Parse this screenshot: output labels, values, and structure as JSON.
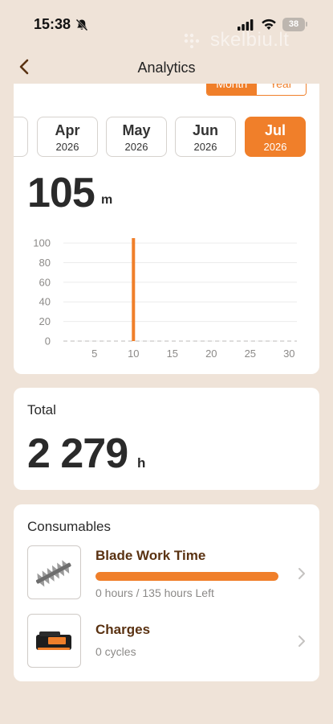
{
  "status_bar": {
    "time": "15:38",
    "battery": "38",
    "watermark": "skelbiu.lt"
  },
  "nav": {
    "title": "Analytics",
    "back_icon": "chevron-left-icon"
  },
  "period_toggle": {
    "options": [
      "Month",
      "Year"
    ],
    "selected": "Month"
  },
  "months": [
    {
      "month": "",
      "year": "",
      "active": false
    },
    {
      "month": "Apr",
      "year": "2026",
      "active": false
    },
    {
      "month": "May",
      "year": "2026",
      "active": false
    },
    {
      "month": "Jun",
      "year": "2026",
      "active": false
    },
    {
      "month": "Jul",
      "year": "2026",
      "active": true
    }
  ],
  "summary": {
    "value": "105",
    "unit": "m"
  },
  "chart_data": {
    "type": "bar",
    "x": [
      10
    ],
    "values": [
      105
    ],
    "xticks": [
      "5",
      "10",
      "15",
      "20",
      "25",
      "30"
    ],
    "yticks": [
      "0",
      "20",
      "40",
      "60",
      "80",
      "100"
    ],
    "xlim": [
      1,
      31
    ],
    "ylim": [
      0,
      105
    ],
    "grid": true,
    "color": "#f07f2a"
  },
  "total": {
    "label": "Total",
    "value": "2 279",
    "unit": "h"
  },
  "consumables": {
    "title": "Consumables",
    "items": [
      {
        "name": "Blade Work Time",
        "status": "0 hours / 135 hours Left",
        "progress": 1.0,
        "icon": "hedge-trimmer-blade-icon"
      },
      {
        "name": "Charges",
        "status": "0 cycles",
        "icon": "battery-pack-icon"
      }
    ]
  },
  "colors": {
    "accent": "#f07f2a",
    "background": "#efe3d8",
    "item_title": "#5a3212"
  }
}
